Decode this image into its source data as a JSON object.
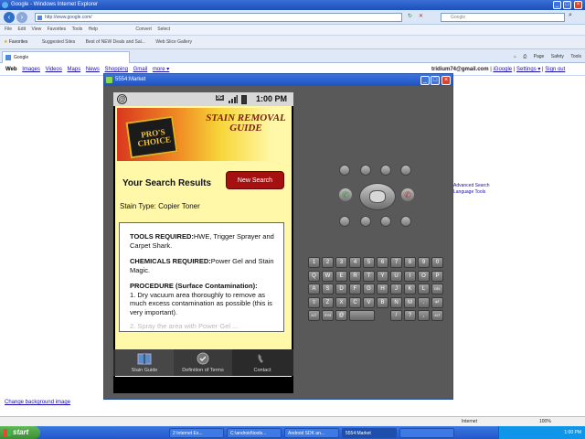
{
  "ie": {
    "window_title": "Google - Windows Internet Explorer",
    "address": "http://www.google.com/",
    "search_placeholder": "Google",
    "menu": [
      "File",
      "Edit",
      "View",
      "Favorites",
      "Tools",
      "Help"
    ],
    "toolbar_items": [
      "Convert",
      "Select"
    ],
    "favorites_label": "Favorites",
    "favorites_links": [
      "Suggested Sites",
      "Best of NEW Deals and Sal...",
      "Web Slice Gallery"
    ],
    "tab_label": "Google",
    "cmd": [
      "Page",
      "Safety",
      "Tools"
    ],
    "status": {
      "zone": "Internet",
      "zoom": "100%"
    }
  },
  "google": {
    "links": [
      "Web",
      "Images",
      "Videos",
      "Maps",
      "News",
      "Shopping",
      "Gmail",
      "more ▾"
    ],
    "user_email": "tridium74@gmail.com",
    "user_links": [
      "iGoogle",
      "Settings ▾",
      "Sign out"
    ],
    "side_links": [
      "Advanced Search",
      "Language Tools"
    ],
    "bg_link": "Change background image"
  },
  "emulator": {
    "window_title": "5554:Market",
    "status_time": "1:00 PM",
    "network": "3G",
    "banner_logo": "PRO'S CHOICE",
    "banner_title": "STAIN REMOVAL GUIDE",
    "results_heading": "Your Search Results",
    "new_search": "New Search",
    "stain_type": "Stain Type: Copier Toner",
    "tools_label": "TOOLS REQUIRED:",
    "tools_value": "HWE, Trigger Sprayer and Carpet Shark.",
    "chemicals_label": "CHEMICALS REQUIRED:",
    "chemicals_value": "Power Gel and Stain Magic.",
    "procedure_label": "PROCEDURE (Surface Contamination):",
    "procedure_step": "1.    Dry vacuum area thoroughly to remove as much excess contamination as possible (this is very important).",
    "procedure_more": "2.    Spray the area with Power Gel ...",
    "tabs": [
      "Stain Guide",
      "Definition of Terms",
      "Contact"
    ],
    "keys_row1": [
      "1",
      "2",
      "3",
      "4",
      "5",
      "6",
      "7",
      "8",
      "9",
      "0"
    ],
    "keys_row2": [
      "Q",
      "W",
      "E",
      "R",
      "T",
      "Y",
      "U",
      "I",
      "O",
      "P"
    ],
    "keys_row3": [
      "A",
      "S",
      "D",
      "F",
      "G",
      "H",
      "J",
      "K",
      "L",
      "DEL"
    ],
    "keys_row4": [
      "⇧",
      "Z",
      "X",
      "C",
      "V",
      "B",
      "N",
      "M",
      ".",
      "↵"
    ],
    "keys_row5": [
      "ALT",
      "SYM",
      "@",
      "",
      "",
      "/",
      "?",
      ",",
      "ALT"
    ]
  },
  "taskbar": {
    "start": "start",
    "items": [
      "2 Internet Ex...",
      "C:\\android\\tools...",
      "Android SDK an...",
      "5554:Market",
      ""
    ],
    "clock": "1:00 PM"
  }
}
